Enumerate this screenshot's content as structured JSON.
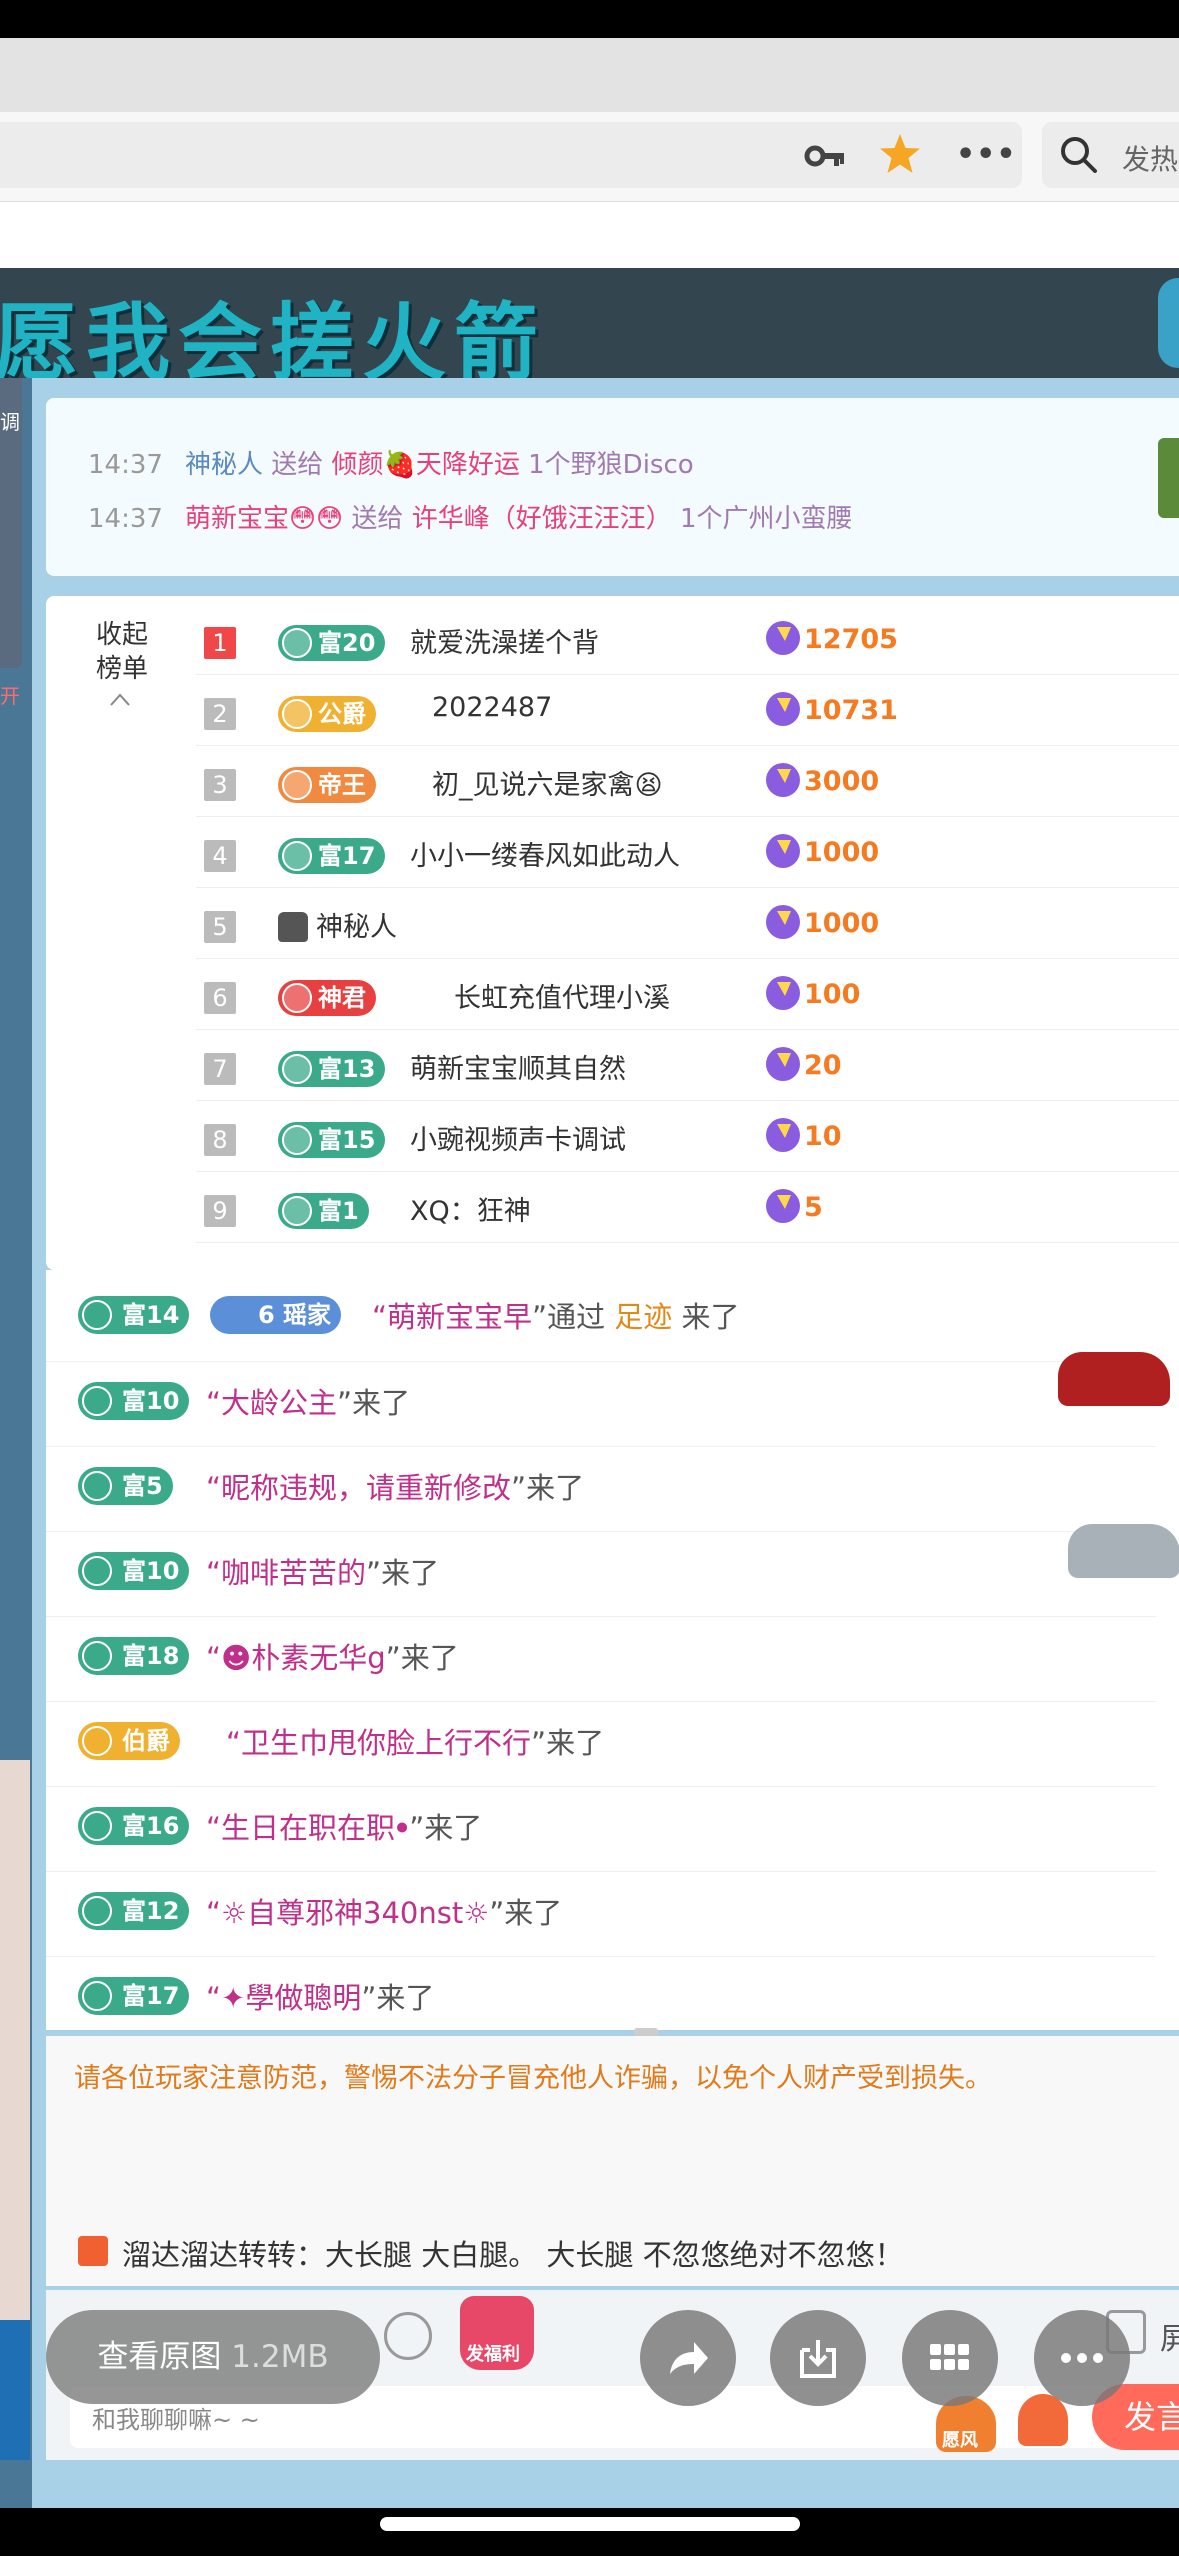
{
  "browser": {
    "search_text": "发热",
    "icons": [
      "key-icon",
      "star-icon",
      "more-icon",
      "search-icon"
    ]
  },
  "banner": {
    "title": "愿我会搓火箭"
  },
  "left_edge": {
    "label_top": "调",
    "label_bottom": "开"
  },
  "gift_feed": [
    {
      "time": "14:37",
      "sender": "神秘人",
      "verb": "送给",
      "receiver": "倾颜🍓天降好运",
      "gift": "1个野狼Disco"
    },
    {
      "time": "14:37",
      "sender": "萌新宝宝😳😳",
      "verb": "送给",
      "receiver": "许华峰（好饿汪汪汪）",
      "gift": "1个广州小蛮腰"
    }
  ],
  "ranking": {
    "collapse_label": "收起榜单",
    "rows": [
      {
        "rank": "1",
        "badge": "富20",
        "badge_type": "fu",
        "name": "就爱洗澡搓个背",
        "score": "12705"
      },
      {
        "rank": "2",
        "badge": "公爵",
        "badge_type": "gong",
        "name": "2022487",
        "score": "10731"
      },
      {
        "rank": "3",
        "badge": "帝王",
        "badge_type": "di",
        "name": "初_见说六是家禽😫",
        "score": "3000"
      },
      {
        "rank": "4",
        "badge": "富17",
        "badge_type": "fu",
        "name": "小小一缕春风如此动人",
        "score": "1000"
      },
      {
        "rank": "5",
        "badge": "",
        "badge_type": "none",
        "name": "神秘人",
        "score": "1000"
      },
      {
        "rank": "6",
        "badge": "神君",
        "badge_type": "shen",
        "name": "长虹充值代理小溪",
        "score": "100"
      },
      {
        "rank": "7",
        "badge": "富13",
        "badge_type": "fu",
        "name": "萌新宝宝顺其自然",
        "score": "20"
      },
      {
        "rank": "8",
        "badge": "富15",
        "badge_type": "fu",
        "name": "小豌视频声卡调试",
        "score": "10"
      },
      {
        "rank": "9",
        "badge": "富1",
        "badge_type": "fu",
        "name": "XQ：狂神",
        "score": "5"
      }
    ]
  },
  "chat": [
    {
      "badge": "富14",
      "extra_badge": "6 瑶家",
      "prefix": "“",
      "name": "萌新宝宝早",
      "mid": "”通过 ",
      "source": "足迹",
      "suffix": " 来了"
    },
    {
      "badge": "富10",
      "prefix": "“",
      "name": "大龄公主",
      "suffix": "”来了"
    },
    {
      "badge": "富5",
      "prefix": "“",
      "name": "昵称违规，请重新修改",
      "suffix": "”来了"
    },
    {
      "badge": "富10",
      "prefix": "“",
      "name": "咖啡苦苦的",
      "suffix": "”来了"
    },
    {
      "badge": "富18",
      "prefix": "“",
      "name": "☻朴素无华g",
      "suffix": "”来了"
    },
    {
      "badge": "伯爵",
      "prefix": "“",
      "name": "卫生巾甩你脸上行不行",
      "suffix": "”来了"
    },
    {
      "badge": "富16",
      "prefix": "“",
      "name": "生日在职在职ꔷ",
      "suffix": "”来了"
    },
    {
      "badge": "富12",
      "prefix": "“",
      "name": "☼自尊邪神340nst☼",
      "suffix": "”来了"
    },
    {
      "badge": "富17",
      "prefix": "“",
      "name": "✦學做聰明",
      "suffix": "”来了"
    }
  ],
  "warning": "请各位玩家注意防范，警惕不法分子冒充他人诈骗，以免个人财产受到损失。",
  "notice": "溜达溜达转转：大长腿 大白腿。 大长腿 不忽悠绝对不忽悠！",
  "input": {
    "placeholder": "和我聊聊嘛~ ~",
    "gift_label": "发福利",
    "rocket_label": "愿风",
    "send_label": "发言",
    "right_char": "屏"
  },
  "viewer": {
    "view_label": "查看原图",
    "size": "1.2MB",
    "buttons": [
      "share-icon",
      "download-icon",
      "grid-icon",
      "more-icon"
    ]
  }
}
